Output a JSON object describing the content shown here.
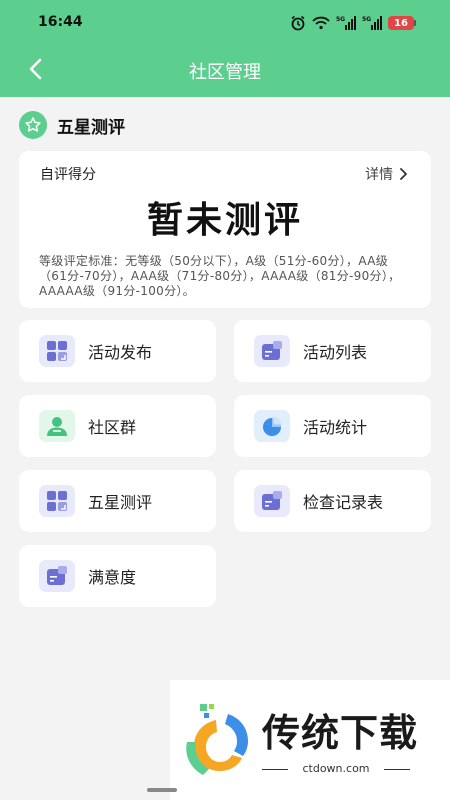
{
  "status_bar": {
    "time": "16:44",
    "network_label": "5G",
    "battery": "16"
  },
  "header": {
    "title": "社区管理"
  },
  "section": {
    "title": "五星测评"
  },
  "score_card": {
    "label": "自评得分",
    "details_label": "详情",
    "value": "暂未测评",
    "standard": "等级评定标准：无等级（50分以下），A级（51分-60分），AA级（61分-70分），AAA级（71分-80分），AAAA级（81分-90分），AAAAA级（91分-100分）。"
  },
  "menu_items": [
    {
      "label": "活动发布",
      "icon": "grid-icon"
    },
    {
      "label": "活动列表",
      "icon": "document-icon"
    },
    {
      "label": "社区群",
      "icon": "person-icon"
    },
    {
      "label": "活动统计",
      "icon": "pie-chart-icon"
    },
    {
      "label": "五星测评",
      "icon": "grid-icon"
    },
    {
      "label": "检查记录表",
      "icon": "document-icon"
    },
    {
      "label": "满意度",
      "icon": "document-icon"
    }
  ],
  "promo": {
    "title": "传统下载",
    "url": "ctdown.com"
  },
  "colors": {
    "brand_green": "#5ccf8f",
    "icon_purple": "#6b6fd4",
    "icon_green": "#46c280",
    "icon_blue": "#3d8ee6"
  }
}
